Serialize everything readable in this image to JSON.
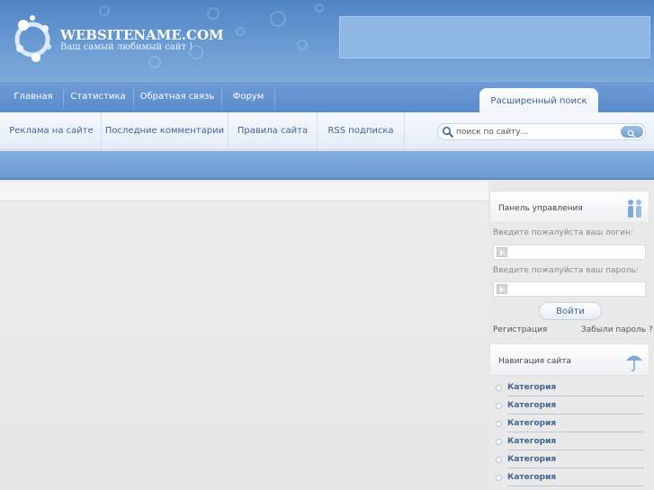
{
  "header": {
    "site_title": "WEBSITENAME.COM",
    "slogan": "Ваш самый любимый сайт !"
  },
  "topnav": {
    "items": [
      "Главная",
      "Статистика",
      "Обратная связь",
      "Форум"
    ],
    "advanced_search": "Расширенный поиск"
  },
  "subnav": {
    "items": [
      "Реклама на сайте",
      "Последние комментарии",
      "Правила сайта",
      "RSS подписка"
    ]
  },
  "search": {
    "placeholder": "поиск по сайту..."
  },
  "login_panel": {
    "title": "Панель управления",
    "login_label": "Введите пожалуйста ваш логин:",
    "password_label": "Введите пожалуйста ваш пароль:",
    "submit": "Войти",
    "register": "Регистрация",
    "forgot": "Забыли пароль ?"
  },
  "site_nav": {
    "title": "Навигация сайта",
    "items": [
      "Категория",
      "Категория",
      "Категория",
      "Категория",
      "Категория",
      "Категория"
    ]
  },
  "colors": {
    "header_blue": "#5a8bcb",
    "link_blue": "#3f6594"
  }
}
